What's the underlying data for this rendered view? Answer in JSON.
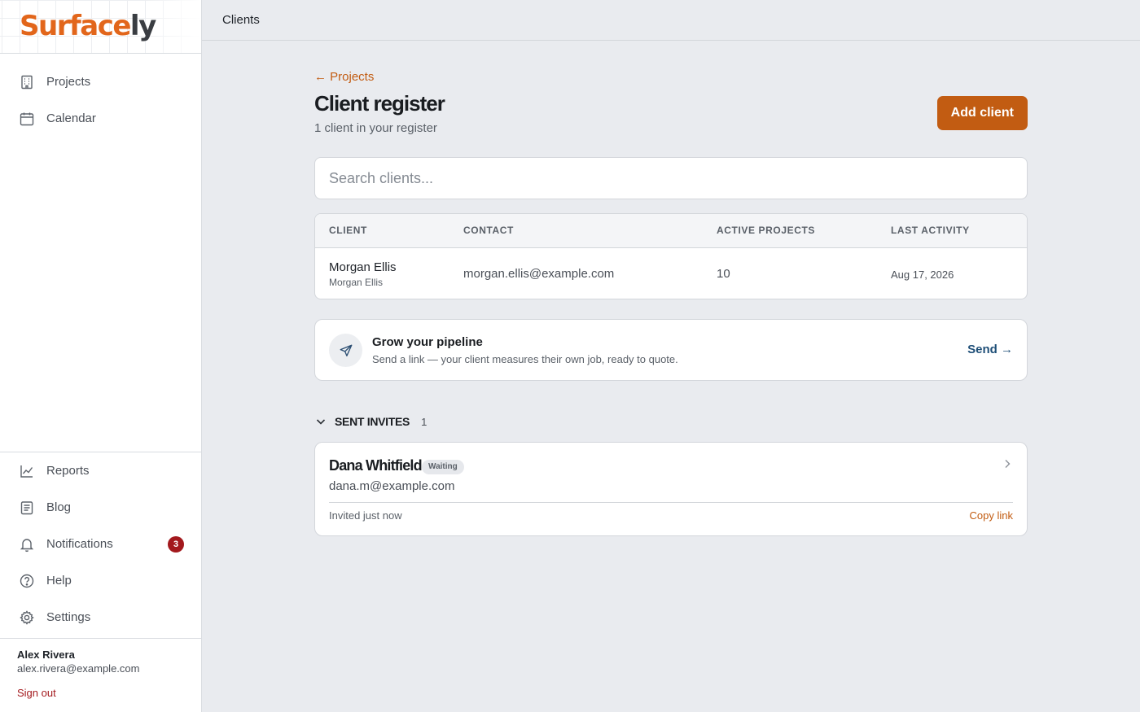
{
  "brand": {
    "logo_part1": "Surface",
    "logo_part2": "ly",
    "accent": "#c25c12"
  },
  "sidebar": {
    "top_items": [
      {
        "label": "Projects",
        "icon": "building-icon"
      },
      {
        "label": "Calendar",
        "icon": "calendar-icon"
      }
    ],
    "bottom_items": [
      {
        "label": "Reports",
        "icon": "chart-line-icon"
      },
      {
        "label": "Blog",
        "icon": "document-icon"
      },
      {
        "label": "Notifications",
        "icon": "bell-icon",
        "badge": "3"
      },
      {
        "label": "Help",
        "icon": "help-circle-icon"
      },
      {
        "label": "Settings",
        "icon": "gear-icon"
      }
    ],
    "user": {
      "name": "Alex Rivera",
      "email": "alex.rivera@example.com",
      "sign_out": "Sign out"
    }
  },
  "topbar": {
    "title": "Clients"
  },
  "main": {
    "back_link": "← Projects",
    "title": "Client register",
    "subtitle": "1 client in your register",
    "add_button": "Add client",
    "search_placeholder": "Search clients...",
    "table": {
      "headers": [
        "CLIENT",
        "CONTACT",
        "ACTIVE PROJECTS",
        "LAST ACTIVITY"
      ],
      "rows": [
        {
          "client": "Morgan Ellis",
          "client_sub": "Morgan Ellis",
          "contact": "morgan.ellis@example.com",
          "active_projects": "10",
          "last_activity": "Aug 17, 2026"
        }
      ]
    },
    "promo": {
      "title": "Grow your pipeline",
      "text": "Send a link — your client measures their own job, ready to quote.",
      "action": "Send →"
    },
    "invites": {
      "title": "SENT INVITES",
      "count": "1",
      "items": [
        {
          "name": "Dana Whitfield",
          "status": "Waiting",
          "email": "dana.m@example.com",
          "time": "Invited just now",
          "copy": "Copy link"
        }
      ]
    }
  }
}
